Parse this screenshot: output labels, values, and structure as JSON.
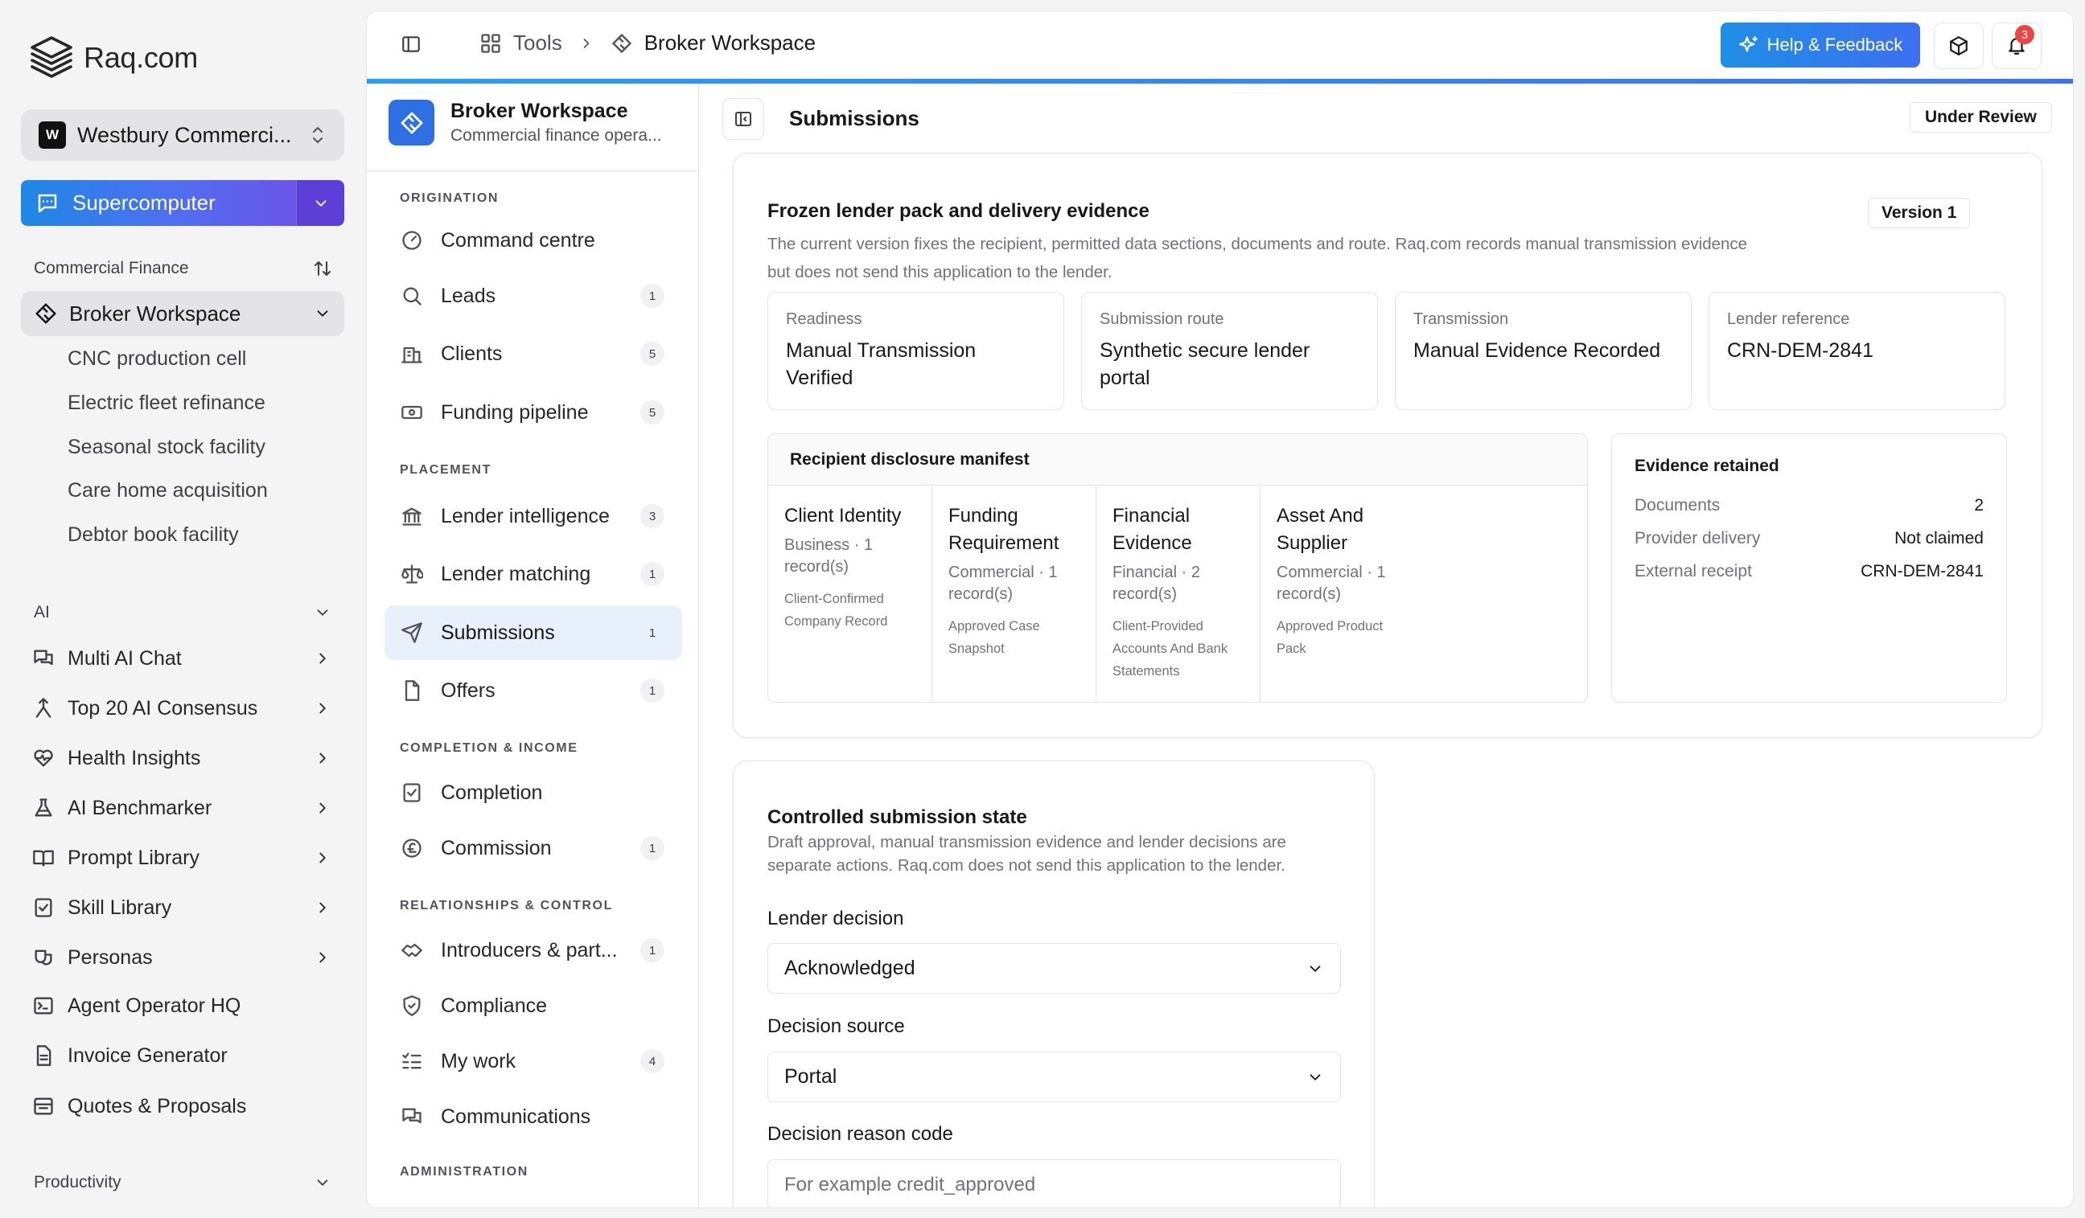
{
  "app": {
    "logo_text": "Raq.com",
    "org": {
      "badge": "W",
      "name": "Westbury Commerci..."
    },
    "supercomputer_label": "Supercomputer",
    "sections": {
      "commercial_finance": "Commercial Finance",
      "ai": "AI",
      "productivity": "Productivity"
    },
    "active_item": "Broker Workspace",
    "sub_items": [
      "CNC production cell",
      "Electric fleet refinance",
      "Seasonal stock facility",
      "Care home acquisition",
      "Debtor book facility"
    ],
    "ai_items": [
      {
        "label": "Multi AI Chat",
        "icon": "chat-icon",
        "has_chevron": true
      },
      {
        "label": "Top 20 AI Consensus",
        "icon": "merge-icon",
        "has_chevron": true
      },
      {
        "label": "Health Insights",
        "icon": "heart-pulse-icon",
        "has_chevron": true
      },
      {
        "label": "AI Benchmarker",
        "icon": "flask-icon",
        "has_chevron": true
      },
      {
        "label": "Prompt Library",
        "icon": "book-open-icon",
        "has_chevron": true
      },
      {
        "label": "Skill Library",
        "icon": "clipboard-check-icon",
        "has_chevron": true
      },
      {
        "label": "Personas",
        "icon": "personas-icon",
        "has_chevron": true
      },
      {
        "label": "Agent Operator HQ",
        "icon": "terminal-icon",
        "has_chevron": false
      },
      {
        "label": "Invoice Generator",
        "icon": "file-text-icon",
        "has_chevron": false
      },
      {
        "label": "Quotes & Proposals",
        "icon": "archive-icon",
        "has_chevron": false
      }
    ]
  },
  "topbar": {
    "breadcrumb_tools": "Tools",
    "breadcrumb_current": "Broker Workspace",
    "help_label": "Help & Feedback",
    "notification_count": "3"
  },
  "workspace": {
    "title": "Broker Workspace",
    "subtitle": "Commercial finance opera...",
    "groups": {
      "origination": "ORIGINATION",
      "placement": "PLACEMENT",
      "completion": "COMPLETION & INCOME",
      "relationships": "RELATIONSHIPS & CONTROL",
      "administration": "ADMINISTRATION"
    },
    "items": [
      {
        "label": "Command centre",
        "icon": "gauge-icon",
        "count": ""
      },
      {
        "label": "Leads",
        "icon": "search-icon",
        "count": "1"
      },
      {
        "label": "Clients",
        "icon": "building-icon",
        "count": "5"
      },
      {
        "label": "Funding pipeline",
        "icon": "banknote-icon",
        "count": "5"
      },
      {
        "label": "Lender intelligence",
        "icon": "landmark-icon",
        "count": "3"
      },
      {
        "label": "Lender matching",
        "icon": "scale-icon",
        "count": "1"
      },
      {
        "label": "Submissions",
        "icon": "send-icon",
        "count": "1"
      },
      {
        "label": "Offers",
        "icon": "file-icon",
        "count": "1"
      },
      {
        "label": "Completion",
        "icon": "clipboard-check-icon",
        "count": ""
      },
      {
        "label": "Commission",
        "icon": "pound-icon",
        "count": "1"
      },
      {
        "label": "Introducers & part...",
        "icon": "handshake-icon",
        "count": "1"
      },
      {
        "label": "Compliance",
        "icon": "shield-check-icon",
        "count": ""
      },
      {
        "label": "My work",
        "icon": "list-todo-icon",
        "count": "4"
      },
      {
        "label": "Communications",
        "icon": "messages-icon",
        "count": ""
      }
    ]
  },
  "content": {
    "title": "Submissions",
    "status": "Under Review",
    "pack": {
      "title": "Frozen lender pack and delivery evidence",
      "version": "Version 1",
      "description_line1": "The current version fixes the recipient, permitted data sections, documents and route. Raq.com records manual transmission evidence",
      "description_line2": "but does not send this application to the lender.",
      "stats": [
        {
          "label": "Readiness",
          "value": "Manual Transmission Verified"
        },
        {
          "label": "Submission route",
          "value": "Synthetic secure lender portal"
        },
        {
          "label": "Transmission",
          "value": "Manual Evidence Recorded"
        },
        {
          "label": "Lender reference",
          "value": "CRN-DEM-2841"
        }
      ],
      "manifest": {
        "title": "Recipient disclosure manifest",
        "columns": [
          {
            "title": "Client Identity",
            "meta": "Business · 1 record(s)",
            "doc": "Client-Confirmed Company Record"
          },
          {
            "title": "Funding Requirement",
            "meta": "Commercial · 1 record(s)",
            "doc": "Approved Case Snapshot"
          },
          {
            "title": "Financial Evidence",
            "meta": "Financial · 2 record(s)",
            "doc": "Client-Provided Accounts And Bank Statements"
          },
          {
            "title": "Asset And Supplier",
            "meta": "Commercial · 1 record(s)",
            "doc": "Approved Product Pack"
          }
        ]
      },
      "evidence": {
        "title": "Evidence retained",
        "rows": [
          {
            "key": "Documents",
            "value": "2"
          },
          {
            "key": "Provider delivery",
            "value": "Not claimed"
          },
          {
            "key": "External receipt",
            "value": "CRN-DEM-2841"
          }
        ]
      }
    },
    "controlled": {
      "title": "Controlled submission state",
      "description_line1": "Draft approval, manual transmission evidence and lender decisions are",
      "description_line2": "separate actions. Raq.com does not send this application to the lender.",
      "lender_decision_label": "Lender decision",
      "lender_decision_value": "Acknowledged",
      "decision_source_label": "Decision source",
      "decision_source_value": "Portal",
      "reason_code_label": "Decision reason code",
      "reason_code_placeholder": "For example credit_approved"
    }
  }
}
